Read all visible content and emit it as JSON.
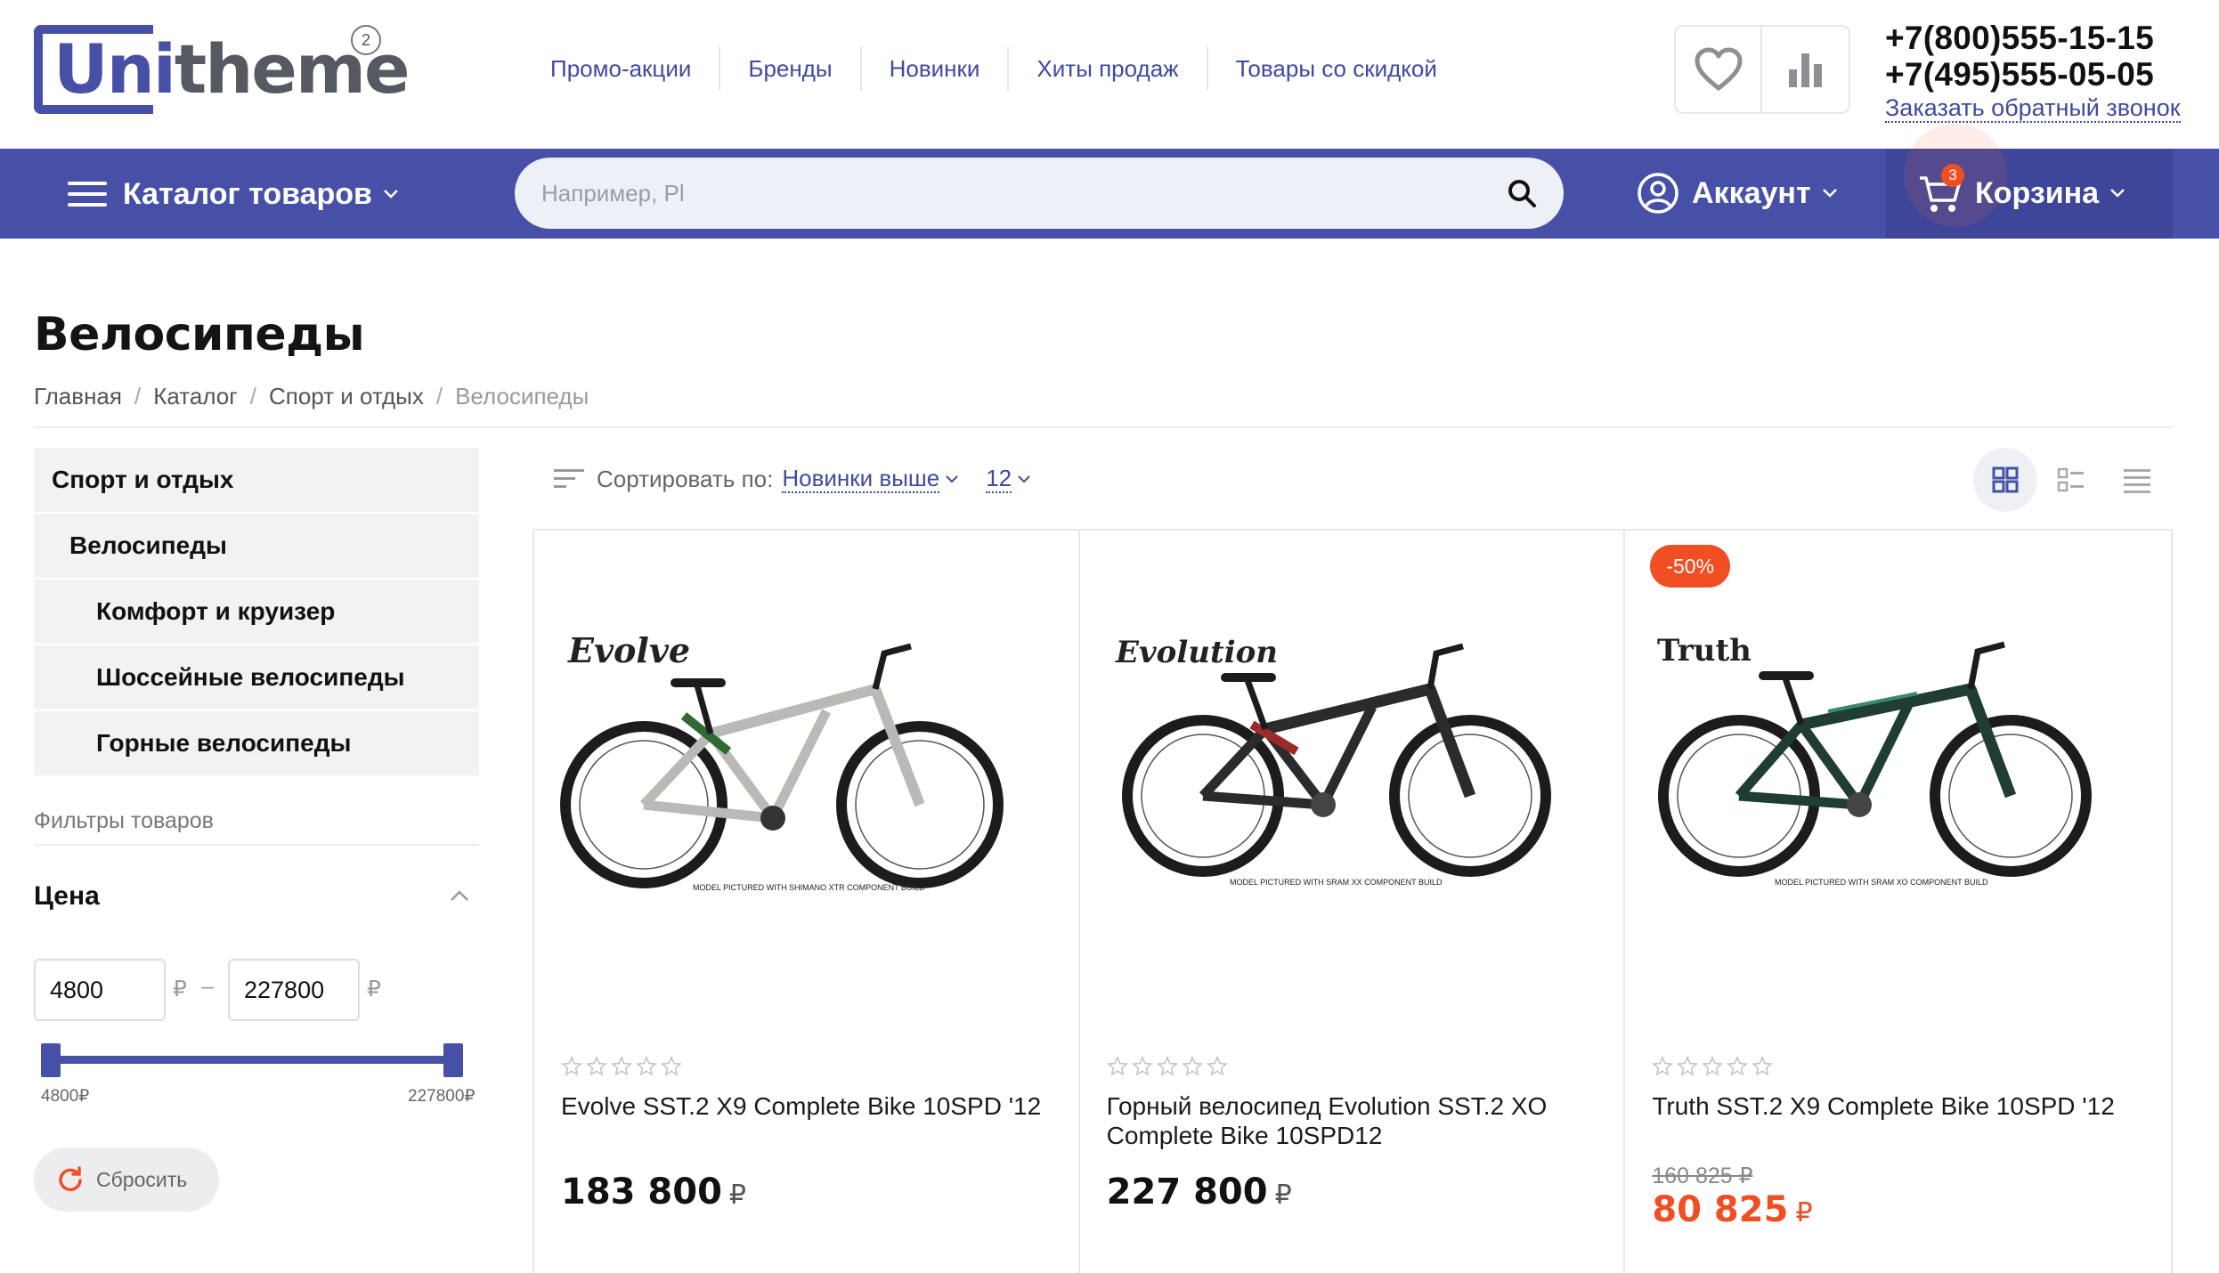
{
  "header": {
    "logo_main": "Uni",
    "logo_rest": "theme",
    "logo_version": "2",
    "nav": [
      "Промо-акции",
      "Бренды",
      "Новинки",
      "Хиты продаж",
      "Товары со скидкой"
    ],
    "phones": [
      "+7(800)555-15-15",
      "+7(495)555-05-05"
    ],
    "callback": "Заказать обратный звонок"
  },
  "navbar": {
    "catalog": "Каталог товаров",
    "search_placeholder": "Например, Pl",
    "account": "Аккаунт",
    "cart": "Корзина",
    "cart_count": "3"
  },
  "page": {
    "title": "Велосипеды",
    "breadcrumb": [
      "Главная",
      "Каталог",
      "Спорт и отдых",
      "Велосипеды"
    ]
  },
  "sidebar": {
    "categories": [
      {
        "label": "Спорт и отдых",
        "level": 0
      },
      {
        "label": "Велосипеды",
        "level": 1
      },
      {
        "label": "Комфорт и круизер",
        "level": 2
      },
      {
        "label": "Шоссейные велосипеды",
        "level": 2
      },
      {
        "label": "Горные велосипеды",
        "level": 2
      }
    ],
    "filters_title": "Фильтры товаров",
    "price_title": "Цена",
    "price_min": "4800",
    "price_max": "227800",
    "currency": "₽",
    "dash": "–",
    "range_min_label": "4800₽",
    "range_max_label": "227800₽",
    "reset": "Сбросить"
  },
  "toolbar": {
    "sort_label": "Сортировать по:",
    "sort_value": "Новинки выше",
    "per_page": "12"
  },
  "products": [
    {
      "name": "Evolve SST.2 X9 Complete Bike 10SPD '12",
      "price": "183 800",
      "currency": "₽",
      "brand": "Evolve",
      "frame_color": "#b9b9b6",
      "caption": "MODEL PICTURED WITH SHIMANO XTR COMPONENT BUILD"
    },
    {
      "name": "Горный велосипед Evolution SST.2 XO Complete Bike 10SPD12",
      "price": "227 800",
      "currency": "₽",
      "brand": "Evolution",
      "frame_color": "#2b2b2d",
      "caption": "MODEL PICTURED WITH SRAM XX COMPONENT BUILD"
    },
    {
      "name": "Truth SST.2 X9 Complete Bike 10SPD '12",
      "old_price": "160 825 ₽",
      "price": "80 825",
      "currency": "₽",
      "badge": "-50%",
      "brand": "Truth",
      "frame_color": "#1f3d30",
      "caption": "MODEL PICTURED WITH SRAM XO COMPONENT BUILD"
    }
  ],
  "colors": {
    "brand": "#4650a6",
    "accent": "#f04e23"
  }
}
